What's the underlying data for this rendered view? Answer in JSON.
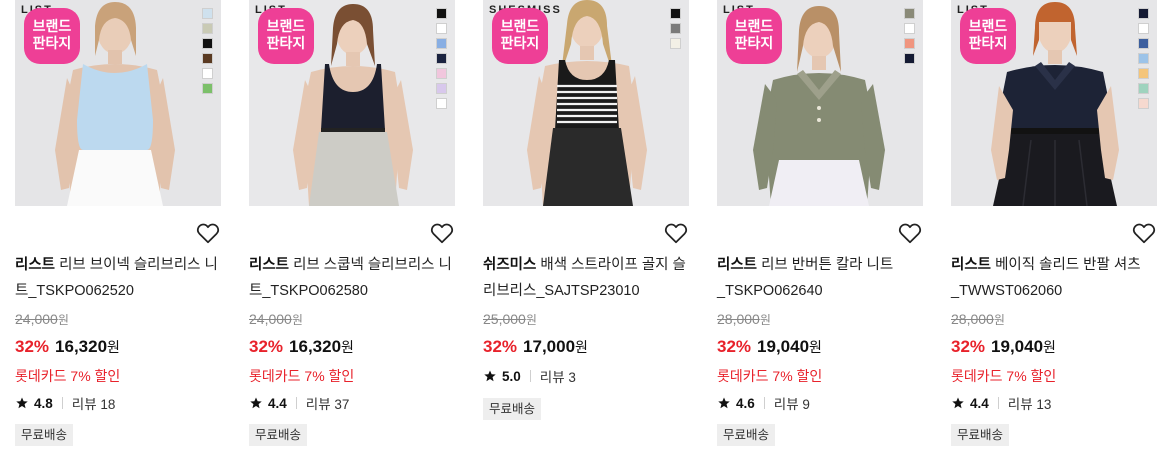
{
  "products": [
    {
      "brand_text": "LIST",
      "badge": [
        "브랜드",
        "판타지"
      ],
      "swatches": [
        "#cfe1ee",
        "#c9cab5",
        "#111111",
        "#5a3a22",
        "#ffffff",
        "#7cc06a"
      ],
      "brand": "리스트",
      "name": "리브 브이넥 슬리브리스 니트_TSKPO062520",
      "original_price": "24,000",
      "original_unit": "원",
      "discount_rate": "32%",
      "price": "16,320",
      "price_unit": "원",
      "card_discount": "롯데카드 7% 할인",
      "rating": "4.8",
      "reviews": "리뷰 18",
      "tag": "무료배송"
    },
    {
      "brand_text": "LIST",
      "badge": [
        "브랜드",
        "판타지"
      ],
      "swatches": [
        "#111111",
        "#ffffff",
        "#88aee3",
        "#1b2340",
        "#f1c6dd",
        "#d8c8ec",
        "#ffffff"
      ],
      "brand": "리스트",
      "name": "리브 스쿱넥 슬리브리스 니트_TSKPO062580",
      "original_price": "24,000",
      "original_unit": "원",
      "discount_rate": "32%",
      "price": "16,320",
      "price_unit": "원",
      "card_discount": "롯데카드 7% 할인",
      "rating": "4.4",
      "reviews": "리뷰 37",
      "tag": "무료배송"
    },
    {
      "brand_text": "SHESMISS",
      "badge": [
        "브랜드",
        "판타지"
      ],
      "swatches": [
        "#111111",
        "#7a7a7a",
        "#f3f0e6"
      ],
      "brand": "쉬즈미스",
      "name": "배색 스트라이프 골지 슬리브리스_SAJTSP23010",
      "original_price": "25,000",
      "original_unit": "원",
      "discount_rate": "32%",
      "price": "17,000",
      "price_unit": "원",
      "card_discount": "",
      "rating": "5.0",
      "reviews": "리뷰 3",
      "tag": "무료배송"
    },
    {
      "brand_text": "LIST",
      "badge": [
        "브랜드",
        "판타지"
      ],
      "swatches": [
        "#8a8a78",
        "#ffffff",
        "#f0957f",
        "#141a33"
      ],
      "brand": "리스트",
      "name": "리브 반버튼 칼라 니트_TSKPO062640",
      "original_price": "28,000",
      "original_unit": "원",
      "discount_rate": "32%",
      "price": "19,040",
      "price_unit": "원",
      "card_discount": "롯데카드 7% 할인",
      "rating": "4.6",
      "reviews": "리뷰 9",
      "tag": "무료배송"
    },
    {
      "brand_text": "LIST",
      "badge": [
        "브랜드",
        "판타지"
      ],
      "swatches": [
        "#141a33",
        "#ffffff",
        "#3d5f9e",
        "#9cc3e8",
        "#f4c57a",
        "#9fd3be",
        "#f6d9cf"
      ],
      "brand": "리스트",
      "name": "베이직 솔리드 반팔 셔츠_TWWST062060",
      "original_price": "28,000",
      "original_unit": "원",
      "discount_rate": "32%",
      "price": "19,040",
      "price_unit": "원",
      "card_discount": "롯데카드 7% 할인",
      "rating": "4.4",
      "reviews": "리뷰 13",
      "tag": "무료배송"
    }
  ]
}
